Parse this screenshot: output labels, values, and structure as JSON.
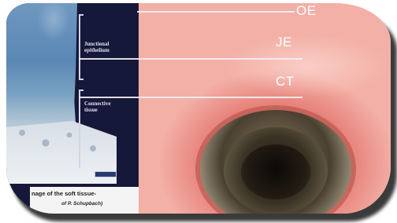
{
  "histology": {
    "label_junctional": [
      "Junctional",
      "epithelium"
    ],
    "label_connective": [
      "Connective",
      "tissue"
    ],
    "caption_line1": "nage of the soft tissue-",
    "caption_line2": "of P. Schupbach)"
  },
  "overlay_labels": {
    "oe": "OE",
    "je": "JE",
    "ct": "CT"
  }
}
